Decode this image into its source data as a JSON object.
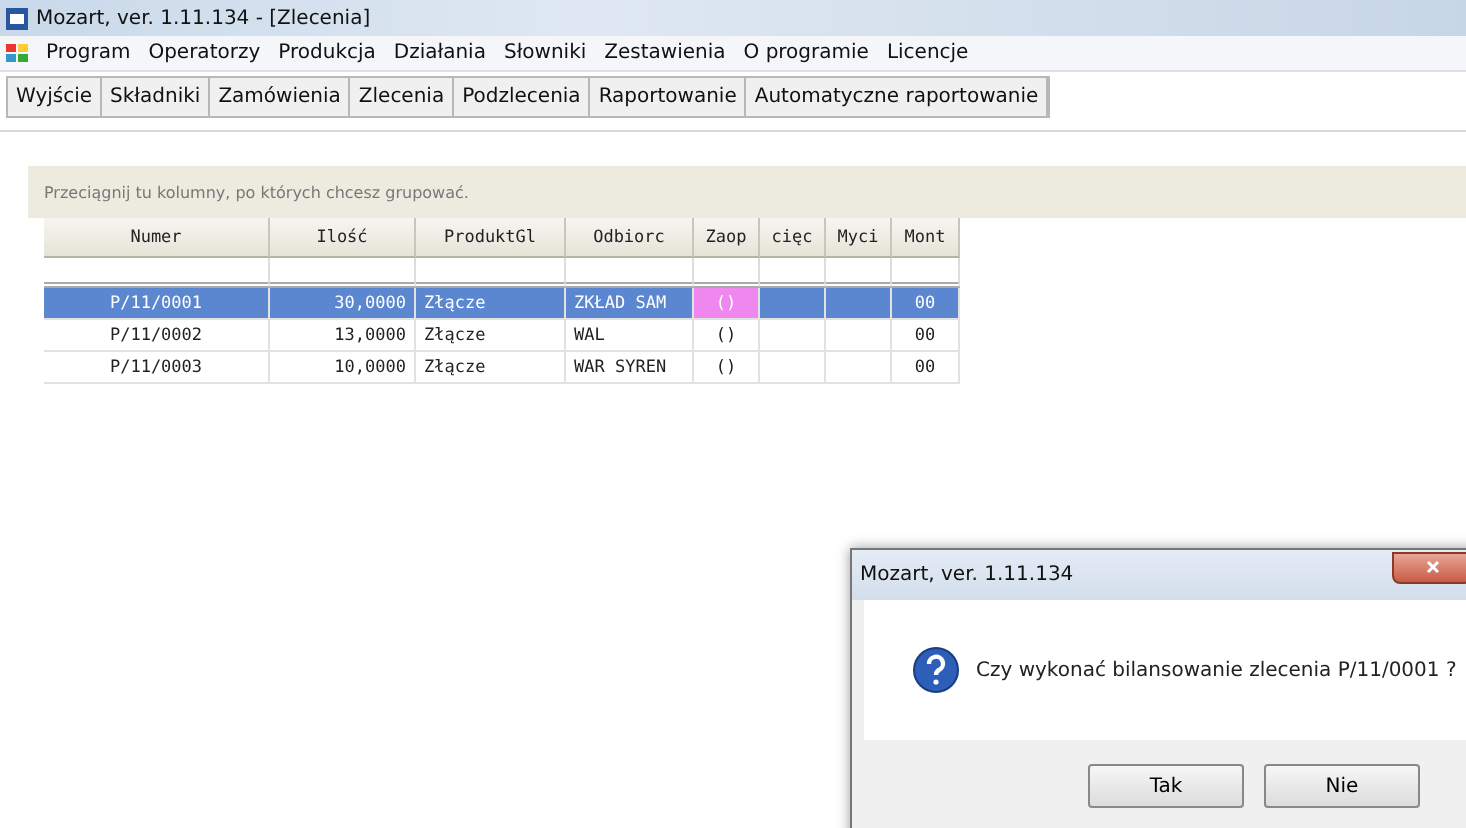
{
  "window": {
    "title": "Mozart, ver. 1.11.134 - [Zlecenia]"
  },
  "menu": [
    "Program",
    "Operatorzy",
    "Produkcja",
    "Działania",
    "Słowniki",
    "Zestawienia",
    "O programie",
    "Licencje"
  ],
  "toolbar": [
    "Wyjście",
    "Składniki",
    "Zamówienia",
    "Zlecenia",
    "Podzlecenia",
    "Raportowanie",
    "Automatyczne raportowanie"
  ],
  "group_hint": "Przeciągnij tu kolumny, po których chcesz grupować.",
  "table": {
    "columns": [
      "Numer",
      "Ilość",
      "ProduktGl",
      "Odbiorc",
      "Zaop",
      "cięc",
      "Myci",
      "Mont"
    ],
    "rows": [
      {
        "selected": true,
        "cells": [
          {
            "text": "P/11/0001",
            "focused": false
          },
          {
            "text": "30,0000",
            "focused": false
          },
          {
            "text": "Złącze",
            "focused": false
          },
          {
            "text": "ZKŁAD SAM",
            "focused": false
          },
          {
            "text": "()",
            "focused": true
          },
          {
            "focused": false
          },
          {
            "focused": false
          },
          {
            "text": "00",
            "focused": false
          }
        ]
      },
      {
        "selected": false,
        "cells": [
          {
            "text": "P/11/0002",
            "focused": false
          },
          {
            "text": "13,0000",
            "focused": false
          },
          {
            "text": "Złącze",
            "focused": false
          },
          {
            "text": "WAL",
            "focused": false
          },
          {
            "text": "()",
            "focused": false
          },
          {
            "focused": false
          },
          {
            "focused": false
          },
          {
            "text": "00",
            "focused": false
          }
        ]
      },
      {
        "selected": false,
        "cells": [
          {
            "text": "P/11/0003",
            "focused": false
          },
          {
            "text": "10,0000",
            "focused": false
          },
          {
            "text": "Złącze",
            "focused": false
          },
          {
            "text": "WAR SYREN",
            "focused": false
          },
          {
            "text": "()",
            "focused": false
          },
          {
            "focused": false
          },
          {
            "focused": false
          },
          {
            "text": "00",
            "focused": false
          }
        ]
      }
    ]
  },
  "dialog": {
    "title": "Mozart, ver. 1.11.134",
    "message": "Czy wykonać bilansowanie zlecenia P/11/0001 ?",
    "buttons": [
      "Tak",
      "Nie"
    ]
  }
}
